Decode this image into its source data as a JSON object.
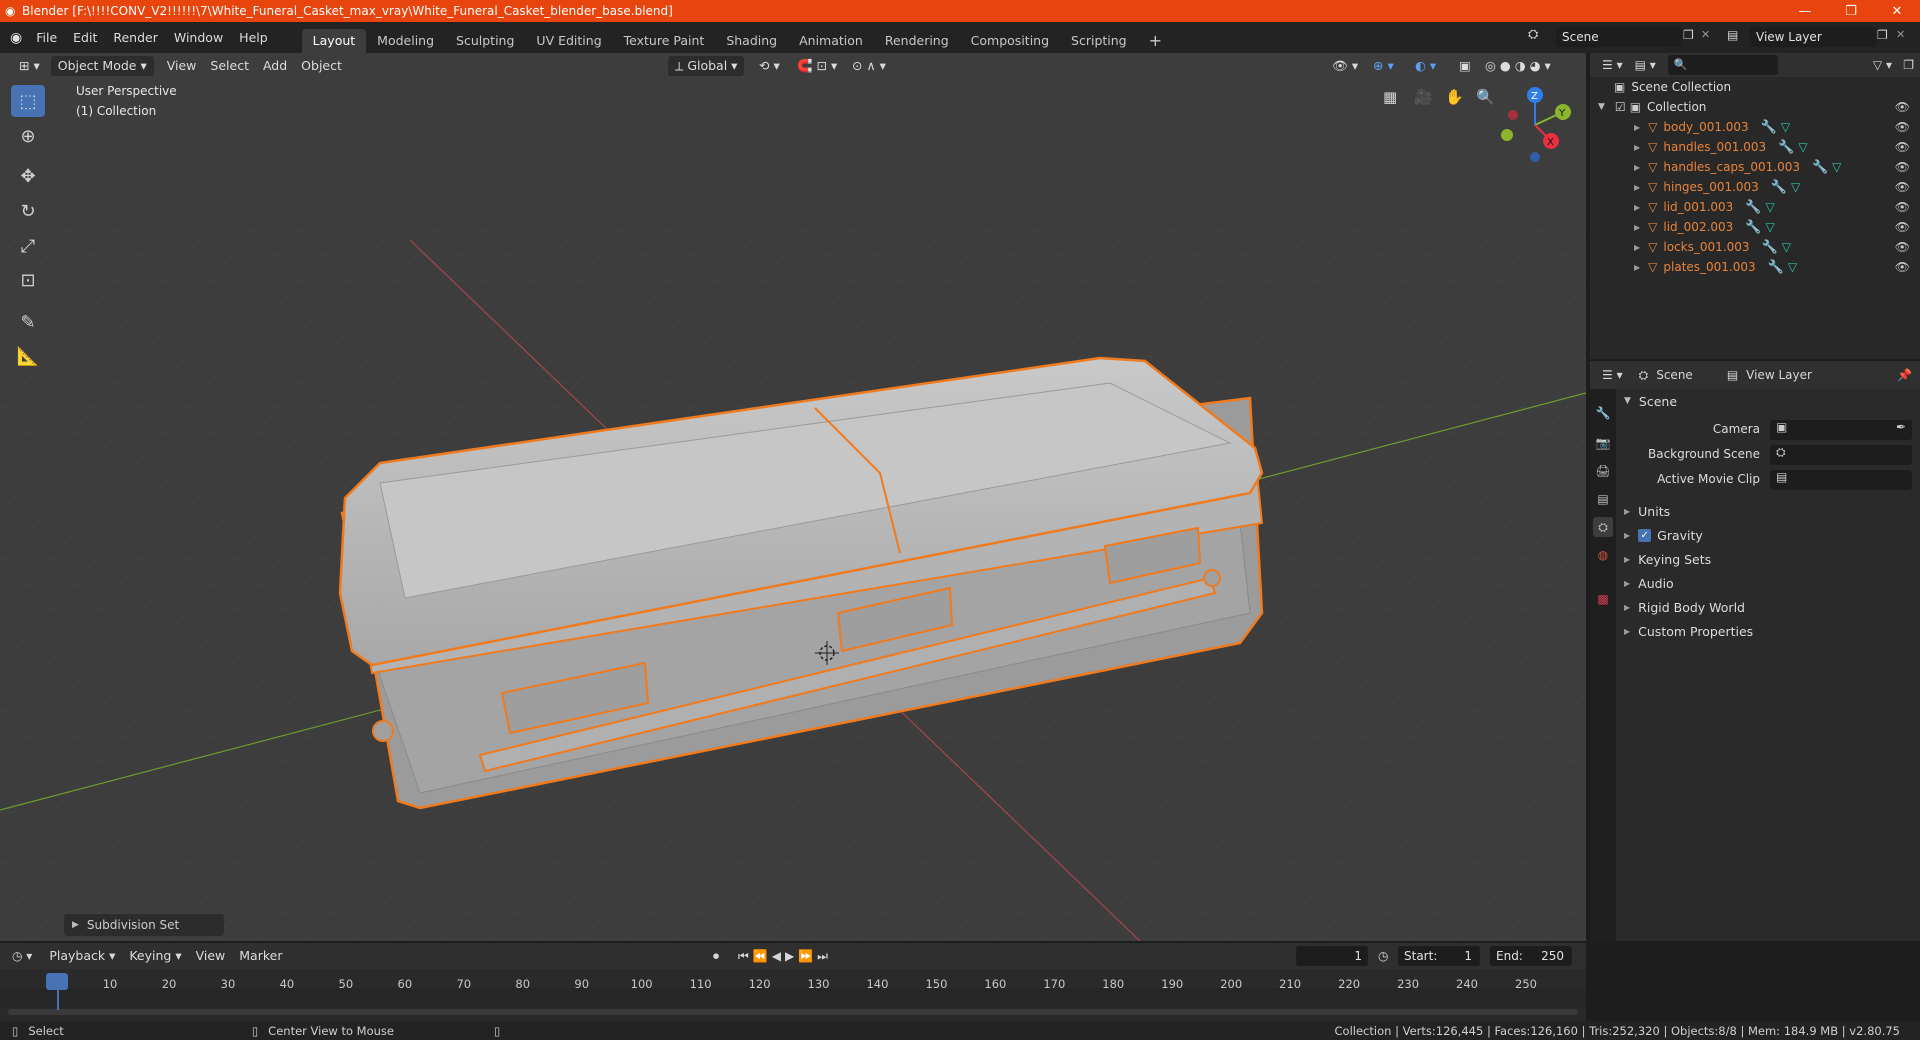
{
  "window": {
    "title": "Blender [F:\\!!!!CONV_V2!!!!!!\\7\\White_Funeral_Casket_max_vray\\White_Funeral_Casket_blender_base.blend]"
  },
  "menu": [
    "File",
    "Edit",
    "Render",
    "Window",
    "Help"
  ],
  "workspaces": [
    "Layout",
    "Modeling",
    "Sculpting",
    "UV Editing",
    "Texture Paint",
    "Shading",
    "Animation",
    "Rendering",
    "Compositing",
    "Scripting"
  ],
  "active_workspace": "Layout",
  "scene_field": "Scene",
  "view_layer_field": "View Layer",
  "viewport": {
    "mode": "Object Mode",
    "menus": [
      "View",
      "Select",
      "Add",
      "Object"
    ],
    "orientation": "Global",
    "perspective_label": "User Perspective",
    "collection_label": "(1) Collection",
    "last_op": "Subdivision Set"
  },
  "outliner": {
    "root": "Scene Collection",
    "collection": "Collection",
    "objects": [
      "body_001.003",
      "handles_001.003",
      "handles_caps_001.003",
      "hinges_001.003",
      "lid_001.003",
      "lid_002.003",
      "locks_001.003",
      "plates_001.003"
    ]
  },
  "properties": {
    "tab_scene": "Scene",
    "tab_view_layer": "View Layer",
    "panel": "Scene",
    "fields": [
      {
        "label": "Camera"
      },
      {
        "label": "Background Scene"
      },
      {
        "label": "Active Movie Clip"
      }
    ],
    "sections": [
      "Units",
      "Gravity",
      "Keying Sets",
      "Audio",
      "Rigid Body World",
      "Custom Properties"
    ],
    "gravity_checked": true
  },
  "timeline": {
    "menus": [
      "Playback",
      "Keying",
      "View",
      "Marker"
    ],
    "current_frame": "1",
    "start_label": "Start:",
    "start": "1",
    "end_label": "End:",
    "end": "250",
    "ticks": [
      "1",
      "10",
      "20",
      "30",
      "40",
      "50",
      "60",
      "70",
      "80",
      "90",
      "100",
      "110",
      "120",
      "130",
      "140",
      "150",
      "160",
      "170",
      "180",
      "190",
      "200",
      "210",
      "220",
      "230",
      "240",
      "250"
    ]
  },
  "status": {
    "select": "Select",
    "center_view": "Center View to Mouse",
    "stats": "Collection | Verts:126,445 | Faces:126,160 | Tris:252,320 | Objects:8/8 | Mem: 184.9 MB | v2.80.75"
  },
  "colors": {
    "titlebar": "#e8440d",
    "selection_outline": "#f07a1e",
    "accent_blue": "#4772b3",
    "object_label": "#e8843a",
    "mesh_icon": "#2ec2a8"
  }
}
